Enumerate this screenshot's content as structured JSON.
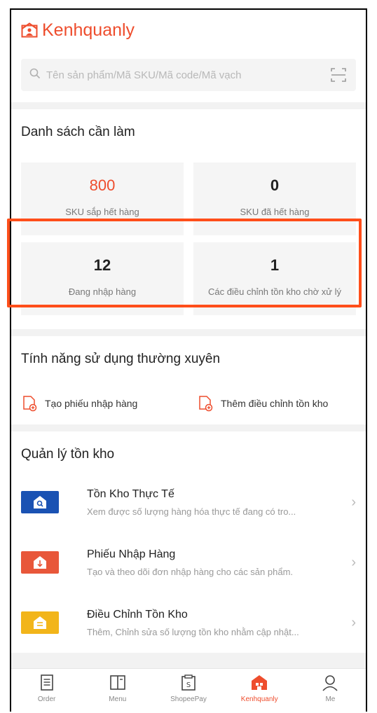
{
  "app": {
    "brand": "Kenhquanly",
    "accent": "#ee4d2d"
  },
  "search": {
    "placeholder": "Tên sản phẩm/Mã SKU/Mã code/Mã vạch",
    "left_icon": "search-icon",
    "right_icon": "scan-icon"
  },
  "todo": {
    "title": "Danh sách cần làm",
    "tiles": [
      {
        "value": "800",
        "label": "SKU sắp hết hàng"
      },
      {
        "value": "0",
        "label": "SKU đã hết hàng"
      },
      {
        "value": "12",
        "label": "Đang nhập hàng"
      },
      {
        "value": "1",
        "label": "Các điều chỉnh tồn kho chờ xử lý"
      }
    ]
  },
  "features": {
    "title": "Tính năng sử dụng thường xuyên",
    "items": [
      {
        "label": "Tạo phiếu nhập hàng",
        "icon": "document-add-icon"
      },
      {
        "label": "Thêm điều chỉnh tồn kho",
        "icon": "document-add-icon"
      }
    ]
  },
  "inventory": {
    "title": "Quản lý tồn kho",
    "items": [
      {
        "title": "Tồn Kho Thực Tế",
        "subtitle": "Xem được số lượng hàng hóa thực tế đang có tro...",
        "icon": "warehouse-search-icon",
        "color": "#1a52b3"
      },
      {
        "title": "Phiếu Nhập Hàng",
        "subtitle": "Tạo và theo dõi đơn nhập hàng cho các sản phẩm.",
        "icon": "warehouse-inbound-icon",
        "color": "#e8573a"
      },
      {
        "title": "Điều Chỉnh Tồn Kho",
        "subtitle": "Thêm, Chỉnh sửa số lượng tồn kho nhằm cập nhật...",
        "icon": "warehouse-adjust-icon",
        "color": "#f2b51a"
      }
    ]
  },
  "tabbar": {
    "items": [
      {
        "label": "Order",
        "icon": "order-icon"
      },
      {
        "label": "Menu",
        "icon": "menu-icon"
      },
      {
        "label": "ShopeePay",
        "icon": "wallet-icon"
      },
      {
        "label": "Kenhquanly",
        "icon": "shop-icon",
        "active": true
      },
      {
        "label": "Me",
        "icon": "user-icon"
      }
    ]
  }
}
